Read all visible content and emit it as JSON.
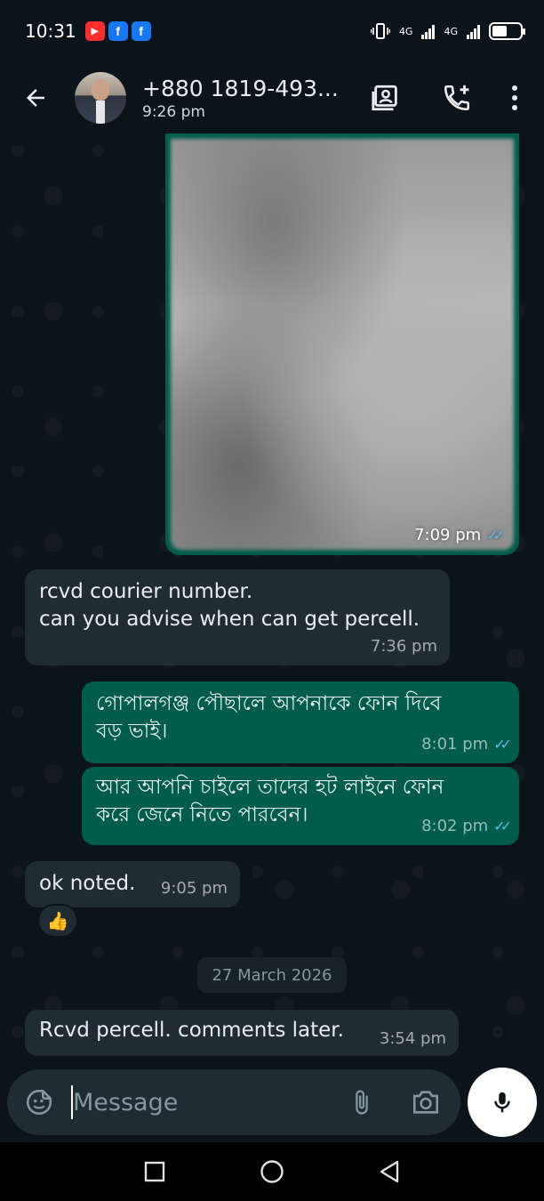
{
  "status_bar": {
    "time": "10:31",
    "notification_icons": [
      "youtube-icon",
      "facebook-icon",
      "facebook-icon"
    ],
    "network_label_1": "4G",
    "network_label_2": "4G"
  },
  "header": {
    "contact_name": "+880 1819-493...",
    "last_seen": "9:26 pm"
  },
  "messages": [
    {
      "type": "image",
      "direction": "outgoing",
      "time": "7:09 pm",
      "status": "read"
    },
    {
      "type": "text",
      "direction": "incoming",
      "lines": [
        "rcvd courier number.",
        "can you advise when can get percell."
      ],
      "time": "7:36 pm"
    },
    {
      "type": "text",
      "direction": "outgoing",
      "lines": [
        "গোপালগঞ্জ পৌছালে আপনাকে ফোন দিবে",
        "বড় ভাই।"
      ],
      "time": "8:01 pm",
      "status": "read"
    },
    {
      "type": "text",
      "direction": "outgoing",
      "lines": [
        "আর আপনি চাইলে তাদের হট লাইনে ফোন",
        "করে জেনে নিতে পারবেন।"
      ],
      "time": "8:02 pm",
      "status": "read"
    },
    {
      "type": "text",
      "direction": "incoming",
      "lines": [
        "ok noted."
      ],
      "time": "9:05 pm",
      "reaction": "👍"
    },
    {
      "type": "date",
      "text": "27 March 2026"
    },
    {
      "type": "text",
      "direction": "incoming",
      "lines": [
        "Rcvd percell. comments later."
      ],
      "time": "3:54 pm"
    }
  ],
  "composer": {
    "placeholder": "Message"
  },
  "colors": {
    "background": "#0b141a",
    "incoming_bubble": "#202c33",
    "outgoing_bubble": "#005c4b",
    "read_ticks": "#53bdeb"
  }
}
